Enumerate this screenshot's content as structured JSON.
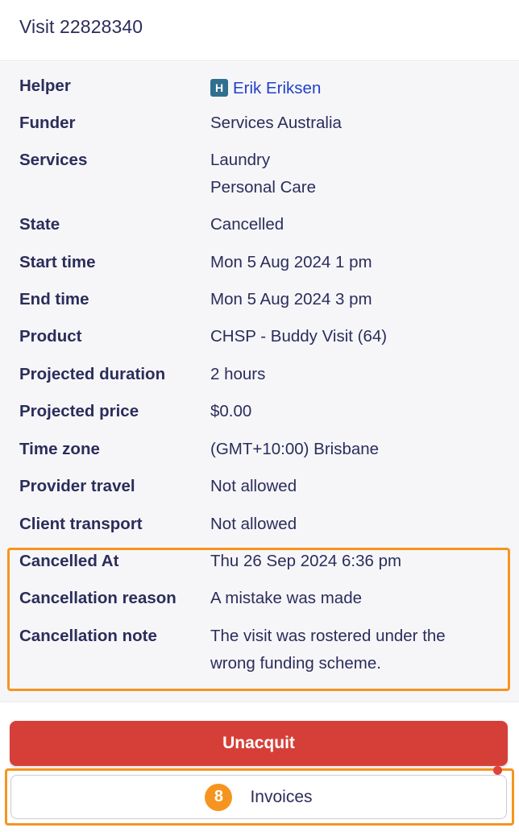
{
  "header": {
    "title": "Visit 22828340"
  },
  "details": {
    "helper": {
      "label": "Helper",
      "badge": "H",
      "name": "Erik Eriksen"
    },
    "funder": {
      "label": "Funder",
      "value": "Services Australia"
    },
    "services": {
      "label": "Services",
      "values": [
        "Laundry",
        "Personal Care"
      ]
    },
    "state": {
      "label": "State",
      "value": "Cancelled"
    },
    "start_time": {
      "label": "Start time",
      "value": "Mon 5 Aug 2024 1 pm"
    },
    "end_time": {
      "label": "End time",
      "value": "Mon 5 Aug 2024 3 pm"
    },
    "product": {
      "label": "Product",
      "value": "CHSP - Buddy Visit (64)"
    },
    "projected_duration": {
      "label": "Projected duration",
      "value": "2 hours"
    },
    "projected_price": {
      "label": "Projected price",
      "value": "$0.00"
    },
    "time_zone": {
      "label": "Time zone",
      "value": "(GMT+10:00) Brisbane"
    },
    "provider_travel": {
      "label": "Provider travel",
      "value": "Not allowed"
    },
    "client_transport": {
      "label": "Client transport",
      "value": "Not allowed"
    },
    "cancelled_at": {
      "label": "Cancelled At",
      "value": "Thu 26 Sep 2024 6:36 pm"
    },
    "cancellation_reason": {
      "label": "Cancellation reason",
      "value": "A mistake was made"
    },
    "cancellation_note": {
      "label": "Cancellation note",
      "lines": [
        "The visit was rostered under the",
        "wrong funding scheme."
      ]
    }
  },
  "actions": {
    "unacquit_label": "Unacquit",
    "invoices_label": "Invoices",
    "invoices_count": "8"
  },
  "colors": {
    "accent_orange": "#f5951f",
    "danger_red": "#d63f38",
    "link_blue": "#2241c7",
    "text_navy": "#2b2d5a"
  }
}
